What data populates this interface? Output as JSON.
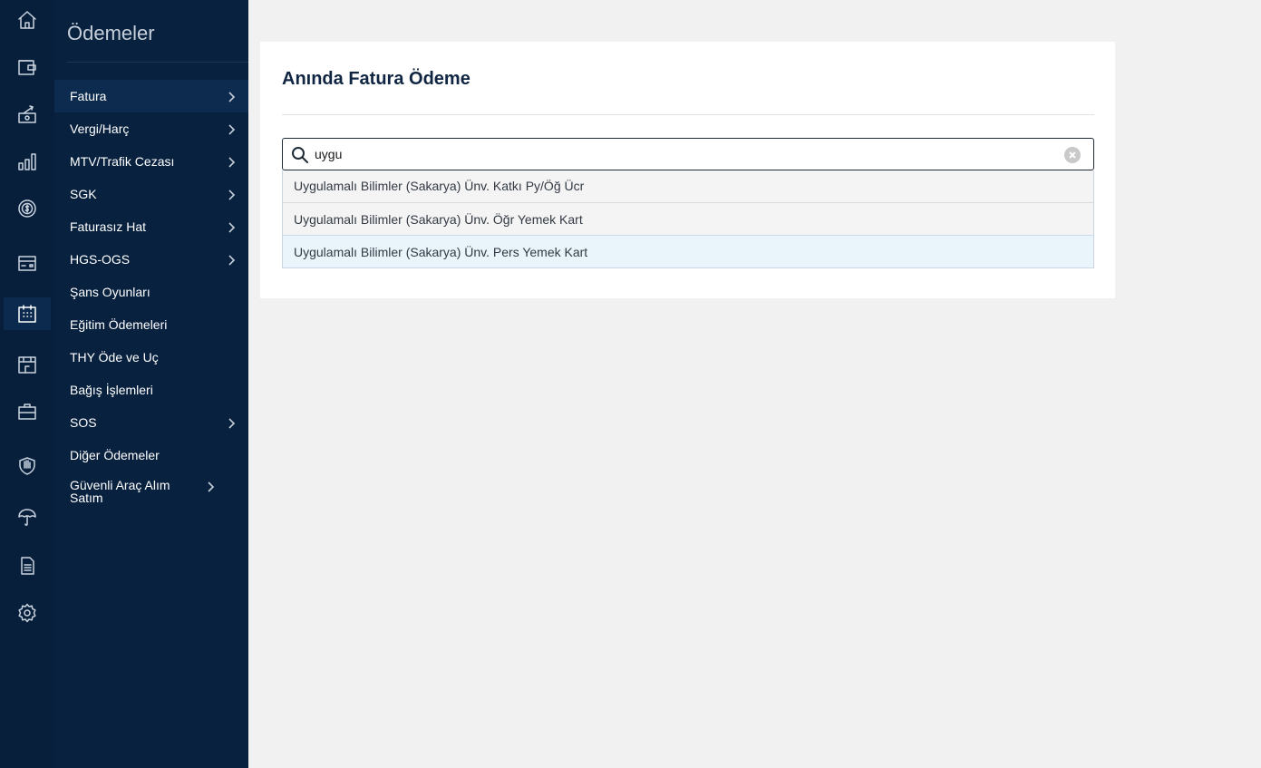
{
  "icon_rail": {
    "items": [
      {
        "icon": "home-icon"
      },
      {
        "icon": "wallet-icon"
      },
      {
        "icon": "money-transfer-icon"
      },
      {
        "icon": "bar-chart-icon"
      },
      {
        "icon": "dollar-coin-icon"
      },
      {
        "icon": "credit-card-icon"
      },
      {
        "icon": "calendar-payments-icon",
        "active": true
      },
      {
        "icon": "building-icon"
      },
      {
        "icon": "briefcase-icon"
      },
      {
        "icon": "shield-icon"
      },
      {
        "icon": "umbrella-icon"
      },
      {
        "icon": "document-icon"
      },
      {
        "icon": "settings-icon"
      }
    ]
  },
  "sidebar": {
    "title": "Ödemeler",
    "items": [
      {
        "label": "Fatura",
        "chevron": true,
        "active": true
      },
      {
        "label": "Vergi/Harç",
        "chevron": true
      },
      {
        "label": "MTV/Trafik Cezası",
        "chevron": true
      },
      {
        "label": "SGK",
        "chevron": true
      },
      {
        "label": "Faturasız Hat",
        "chevron": true
      },
      {
        "label": "HGS-OGS",
        "chevron": true
      },
      {
        "label": "Şans Oyunları",
        "chevron": false
      },
      {
        "label": "Eğitim Ödemeleri",
        "chevron": false
      },
      {
        "label": "THY Öde ve Uç",
        "chevron": false
      },
      {
        "label": "Bağış İşlemleri",
        "chevron": false
      },
      {
        "label": "SOS",
        "chevron": true
      },
      {
        "label": "Diğer Ödemeler",
        "chevron": false
      },
      {
        "label": "Güvenli Araç Alım Satım",
        "chevron": true
      }
    ]
  },
  "main": {
    "title": "Anında Fatura Ödeme",
    "search": {
      "value": "uygu",
      "placeholder": ""
    },
    "results": [
      {
        "label": "Uygulamalı Bilimler (Sakarya) Ünv. Katkı Py/Öğ Ücr"
      },
      {
        "label": "Uygulamalı Bilimler (Sakarya) Ünv. Öğr Yemek Kart"
      },
      {
        "label": "Uygulamalı Bilimler (Sakarya) Ünv. Pers Yemek Kart",
        "highlighted": true
      }
    ]
  },
  "colors": {
    "rail_bg": "#071f3b",
    "sidebar_bg": "#08213f",
    "active_item_bg": "#0c2b4e",
    "page_bg": "#f1f1f1",
    "title_color": "#0f2542",
    "highlight_bg": "#e9f4fb"
  }
}
